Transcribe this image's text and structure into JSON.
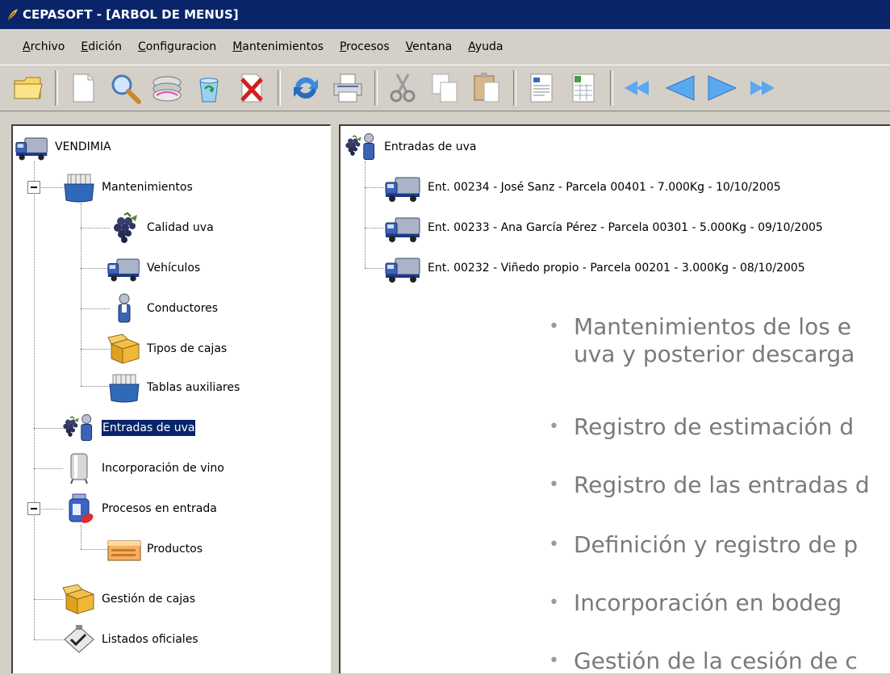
{
  "window": {
    "title": "CEPASOFT - [ARBOL DE MENUS]"
  },
  "menu": [
    "Archivo",
    "Edición",
    "Configuracion",
    "Mantenimientos",
    "Procesos",
    "Ventana",
    "Ayuda"
  ],
  "toolbar": {
    "icons": [
      "folder-icon",
      "new-document-icon",
      "search-icon",
      "disks-icon",
      "recycle-icon",
      "delete-icon",
      "refresh-icon",
      "print-icon",
      "cut-icon",
      "copy-icon",
      "paste-icon",
      "text-document-icon",
      "spreadsheet-icon",
      "first-record-icon",
      "previous-record-icon",
      "next-record-icon",
      "last-record-icon"
    ]
  },
  "tree": {
    "root": "VENDIMIA",
    "mantenimientos": "Mantenimientos",
    "calidad": "Calidad uva",
    "vehiculos": "Vehículos",
    "conductores": "Conductores",
    "tipos_cajas": "Tipos de cajas",
    "tablas": "Tablas auxiliares",
    "entradas": "Entradas de uva",
    "vino": "Incorporación de vino",
    "procesos": "Procesos en entrada",
    "productos": "Productos",
    "gestion_cajas": "Gestión de cajas",
    "listados": "Listados oficiales"
  },
  "detail": {
    "header": "Entradas de uva",
    "entries": [
      "Ent. 00234 - José Sanz - Parcela 00401 - 7.000Kg - 10/10/2005",
      "Ent. 00233 - Ana García Pérez - Parcela 00301 - 5.000Kg - 09/10/2005",
      "Ent. 00232 - Viñedo propio - Parcela 00201 - 3.000Kg - 08/10/2005"
    ]
  },
  "slide_bullets": [
    {
      "line1": "Mantenimientos de los e",
      "line2": "uva y posterior descarga"
    },
    {
      "line1": "Registro de estimación d"
    },
    {
      "line1": "Registro de las entradas d"
    },
    {
      "line1": "Definición y registro de p"
    },
    {
      "line1": "Incorporación en bodeg"
    },
    {
      "line1": "Gestión de la cesión de c"
    }
  ],
  "colors": {
    "titlebar": "#0a246a",
    "selection": "#0a246a",
    "face": "#d4d0c8",
    "bullet_text": "#7a7a7a"
  }
}
